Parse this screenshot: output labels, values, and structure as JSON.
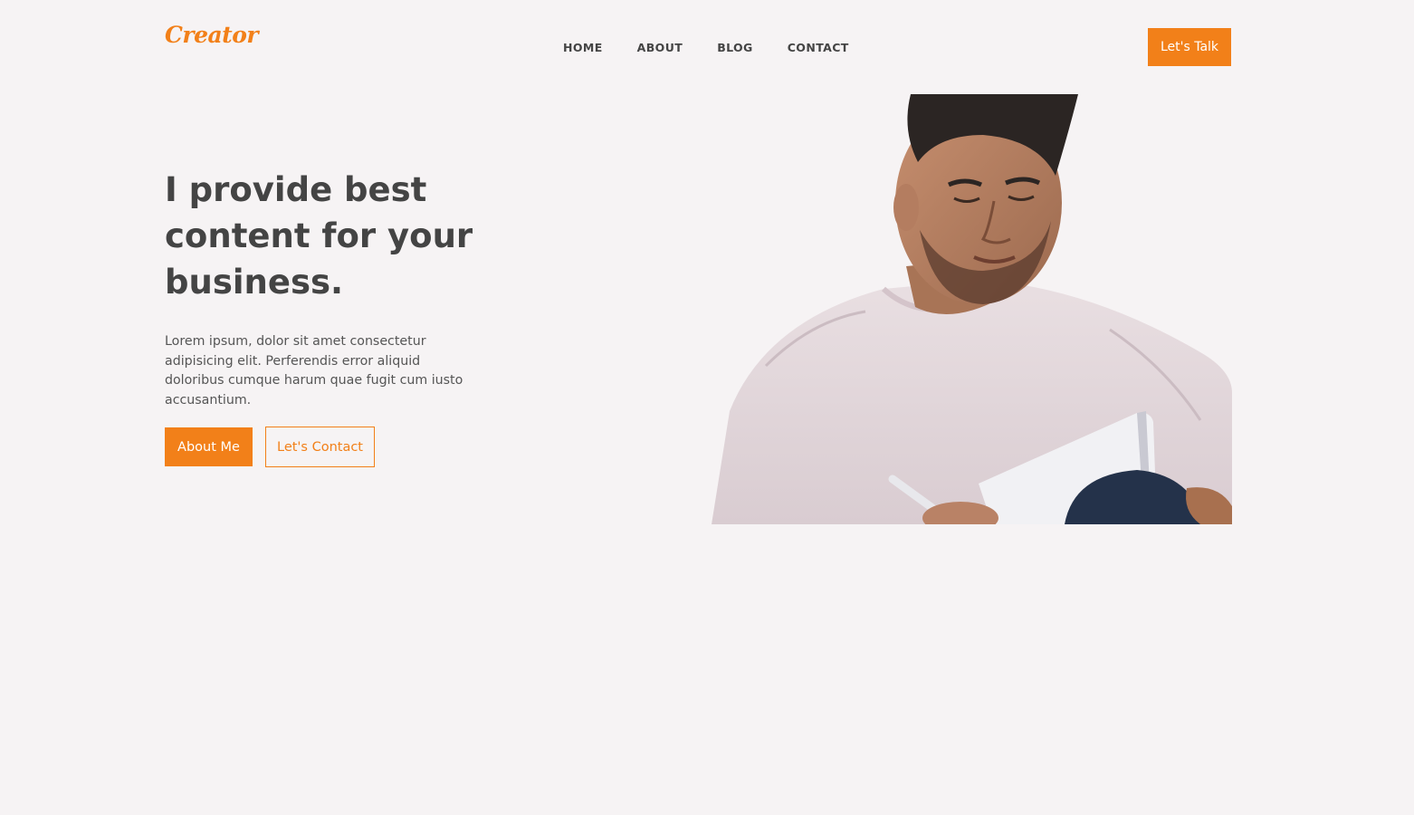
{
  "brand": {
    "logo_text": "Creator",
    "accent_color": "#f28019"
  },
  "nav": {
    "items": [
      {
        "label": "HOME"
      },
      {
        "label": "ABOUT"
      },
      {
        "label": "BLOG"
      },
      {
        "label": "CONTACT"
      }
    ],
    "cta_label": "Let's Talk"
  },
  "hero": {
    "headline": "I provide best content for your business.",
    "description": "Lorem ipsum, dolor sit amet consectetur adipisicing elit. Perferendis error aliquid doloribus cumque harum quae fugit cum iusto accusantium.",
    "primary_button": "About Me",
    "secondary_button": "Let's Contact",
    "image_subject": "man-writing-in-notebook-photo"
  }
}
